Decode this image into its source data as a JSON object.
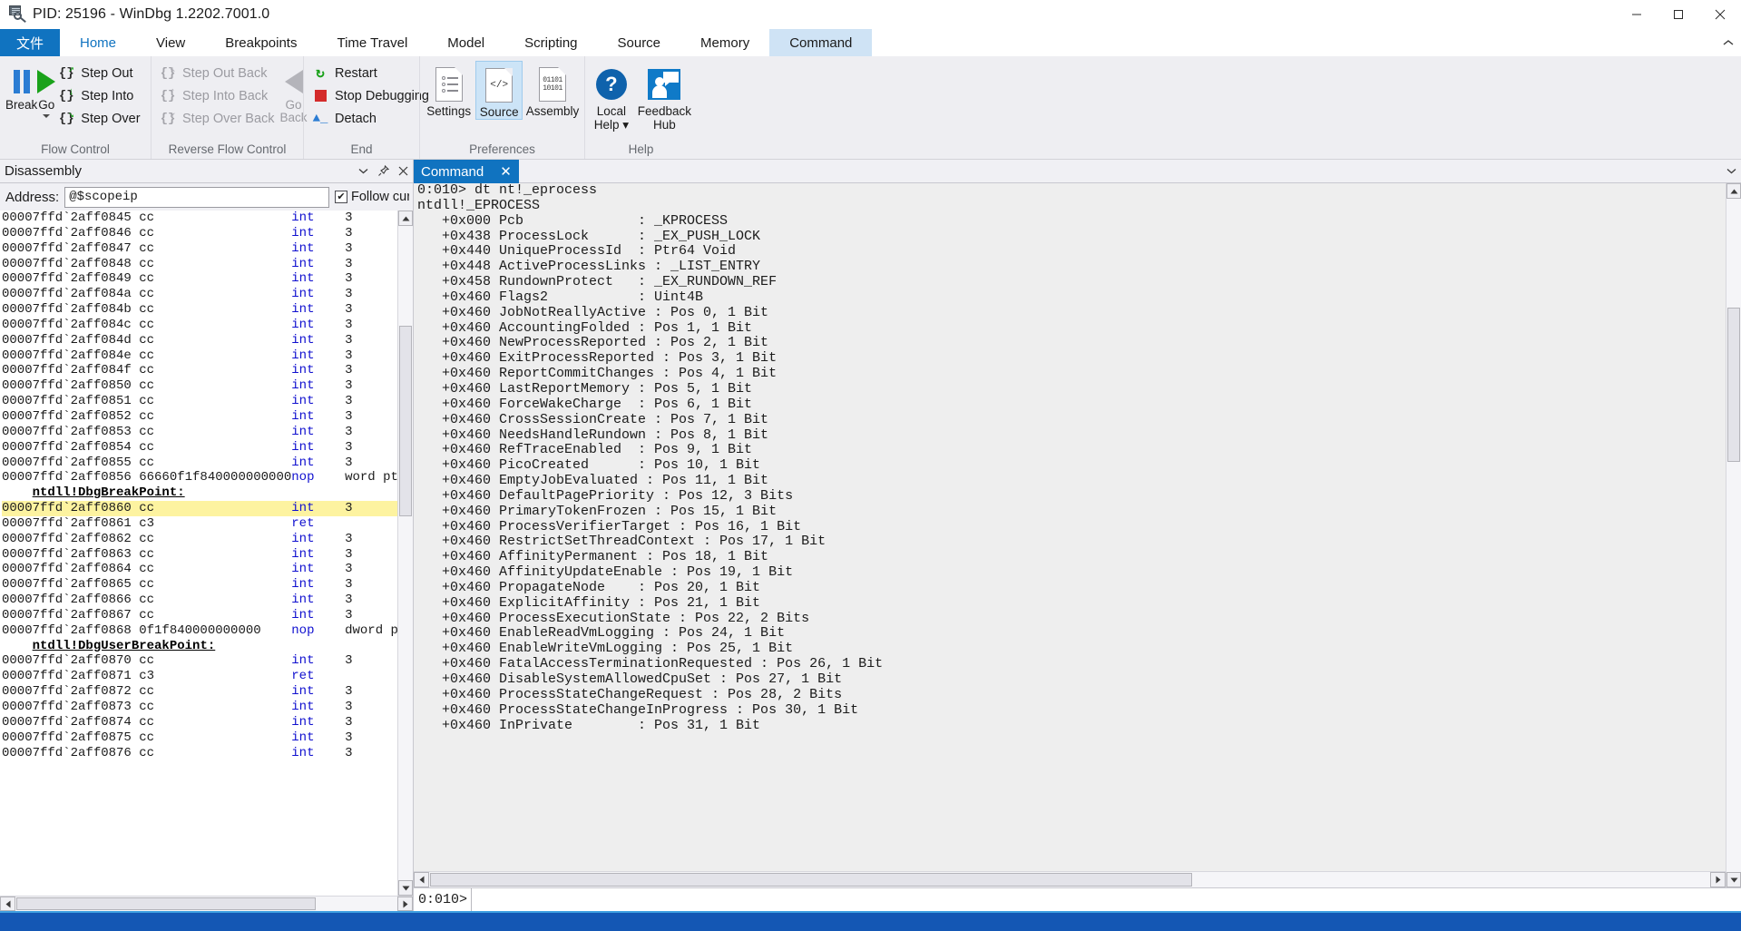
{
  "titlebar": {
    "icon": "windbg-icon",
    "title": "PID: 25196 - WinDbg 1.2202.7001.0",
    "minimize": "—",
    "maximize": "☐",
    "close": "✕"
  },
  "ribbon": {
    "file_tab": "文件",
    "tabs": [
      {
        "label": "Home",
        "active": true,
        "context": false
      },
      {
        "label": "View",
        "active": false,
        "context": false
      },
      {
        "label": "Breakpoints",
        "active": false,
        "context": false
      },
      {
        "label": "Time Travel",
        "active": false,
        "context": false
      },
      {
        "label": "Model",
        "active": false,
        "context": false
      },
      {
        "label": "Scripting",
        "active": false,
        "context": false
      },
      {
        "label": "Source",
        "active": false,
        "context": false
      },
      {
        "label": "Memory",
        "active": false,
        "context": false
      },
      {
        "label": "Command",
        "active": false,
        "context": true
      }
    ],
    "collapse_icon": "chevron-up-icon",
    "groups": {
      "flow_control": {
        "label": "Flow Control",
        "break": "Break",
        "go": "Go",
        "step_out": "Step Out",
        "step_into": "Step Into",
        "step_over": "Step Over"
      },
      "reverse_flow_control": {
        "label": "Reverse Flow Control",
        "step_out_back": "Step Out Back",
        "step_into_back": "Step Into Back",
        "step_over_back": "Step Over Back",
        "go_back_line1": "Go",
        "go_back_line2": "Back"
      },
      "end": {
        "label": "End",
        "restart": "Restart",
        "stop_debugging": "Stop Debugging",
        "detach": "Detach"
      },
      "preferences": {
        "label": "Preferences",
        "settings": "Settings",
        "source": "Source",
        "assembly": "Assembly"
      },
      "help": {
        "label": "Help",
        "local_help_line1": "Local",
        "local_help_line2": "Help",
        "feedback_line1": "Feedback",
        "feedback_line2": "Hub"
      }
    }
  },
  "disassembly": {
    "pane_title": "Disassembly",
    "chevron_icon": "chevron-down-icon",
    "pin_icon": "pin-icon",
    "close_icon": "close-icon",
    "address_label": "Address:",
    "address_value": "@$scopeip",
    "follow_label": "Follow cur",
    "follow_checked": "✔",
    "lines": [
      {
        "addr": "00007ffd`2aff0845",
        "bytes": "cc",
        "mnemonic": "int",
        "operand": "3",
        "highlight": false,
        "symbol": ""
      },
      {
        "addr": "00007ffd`2aff0846",
        "bytes": "cc",
        "mnemonic": "int",
        "operand": "3",
        "highlight": false,
        "symbol": ""
      },
      {
        "addr": "00007ffd`2aff0847",
        "bytes": "cc",
        "mnemonic": "int",
        "operand": "3",
        "highlight": false,
        "symbol": ""
      },
      {
        "addr": "00007ffd`2aff0848",
        "bytes": "cc",
        "mnemonic": "int",
        "operand": "3",
        "highlight": false,
        "symbol": ""
      },
      {
        "addr": "00007ffd`2aff0849",
        "bytes": "cc",
        "mnemonic": "int",
        "operand": "3",
        "highlight": false,
        "symbol": ""
      },
      {
        "addr": "00007ffd`2aff084a",
        "bytes": "cc",
        "mnemonic": "int",
        "operand": "3",
        "highlight": false,
        "symbol": ""
      },
      {
        "addr": "00007ffd`2aff084b",
        "bytes": "cc",
        "mnemonic": "int",
        "operand": "3",
        "highlight": false,
        "symbol": ""
      },
      {
        "addr": "00007ffd`2aff084c",
        "bytes": "cc",
        "mnemonic": "int",
        "operand": "3",
        "highlight": false,
        "symbol": ""
      },
      {
        "addr": "00007ffd`2aff084d",
        "bytes": "cc",
        "mnemonic": "int",
        "operand": "3",
        "highlight": false,
        "symbol": ""
      },
      {
        "addr": "00007ffd`2aff084e",
        "bytes": "cc",
        "mnemonic": "int",
        "operand": "3",
        "highlight": false,
        "symbol": ""
      },
      {
        "addr": "00007ffd`2aff084f",
        "bytes": "cc",
        "mnemonic": "int",
        "operand": "3",
        "highlight": false,
        "symbol": ""
      },
      {
        "addr": "00007ffd`2aff0850",
        "bytes": "cc",
        "mnemonic": "int",
        "operand": "3",
        "highlight": false,
        "symbol": ""
      },
      {
        "addr": "00007ffd`2aff0851",
        "bytes": "cc",
        "mnemonic": "int",
        "operand": "3",
        "highlight": false,
        "symbol": ""
      },
      {
        "addr": "00007ffd`2aff0852",
        "bytes": "cc",
        "mnemonic": "int",
        "operand": "3",
        "highlight": false,
        "symbol": ""
      },
      {
        "addr": "00007ffd`2aff0853",
        "bytes": "cc",
        "mnemonic": "int",
        "operand": "3",
        "highlight": false,
        "symbol": ""
      },
      {
        "addr": "00007ffd`2aff0854",
        "bytes": "cc",
        "mnemonic": "int",
        "operand": "3",
        "highlight": false,
        "symbol": ""
      },
      {
        "addr": "00007ffd`2aff0855",
        "bytes": "cc",
        "mnemonic": "int",
        "operand": "3",
        "highlight": false,
        "symbol": ""
      },
      {
        "addr": "00007ffd`2aff0856",
        "bytes": "66660f1f840000000000",
        "mnemonic": "nop",
        "operand": "word ptr",
        "highlight": false,
        "symbol": ""
      },
      {
        "addr": "",
        "bytes": "",
        "mnemonic": "",
        "operand": "",
        "highlight": false,
        "symbol": "ntdll!DbgBreakPoint:"
      },
      {
        "addr": "00007ffd`2aff0860",
        "bytes": "cc",
        "mnemonic": "int",
        "operand": "3",
        "highlight": true,
        "symbol": ""
      },
      {
        "addr": "00007ffd`2aff0861",
        "bytes": "c3",
        "mnemonic": "ret",
        "operand": "",
        "highlight": false,
        "symbol": ""
      },
      {
        "addr": "00007ffd`2aff0862",
        "bytes": "cc",
        "mnemonic": "int",
        "operand": "3",
        "highlight": false,
        "symbol": ""
      },
      {
        "addr": "00007ffd`2aff0863",
        "bytes": "cc",
        "mnemonic": "int",
        "operand": "3",
        "highlight": false,
        "symbol": ""
      },
      {
        "addr": "00007ffd`2aff0864",
        "bytes": "cc",
        "mnemonic": "int",
        "operand": "3",
        "highlight": false,
        "symbol": ""
      },
      {
        "addr": "00007ffd`2aff0865",
        "bytes": "cc",
        "mnemonic": "int",
        "operand": "3",
        "highlight": false,
        "symbol": ""
      },
      {
        "addr": "00007ffd`2aff0866",
        "bytes": "cc",
        "mnemonic": "int",
        "operand": "3",
        "highlight": false,
        "symbol": ""
      },
      {
        "addr": "00007ffd`2aff0867",
        "bytes": "cc",
        "mnemonic": "int",
        "operand": "3",
        "highlight": false,
        "symbol": ""
      },
      {
        "addr": "00007ffd`2aff0868",
        "bytes": "0f1f840000000000",
        "mnemonic": "nop",
        "operand": "dword pt",
        "highlight": false,
        "symbol": ""
      },
      {
        "addr": "",
        "bytes": "",
        "mnemonic": "",
        "operand": "",
        "highlight": false,
        "symbol": "ntdll!DbgUserBreakPoint:"
      },
      {
        "addr": "00007ffd`2aff0870",
        "bytes": "cc",
        "mnemonic": "int",
        "operand": "3",
        "highlight": false,
        "symbol": ""
      },
      {
        "addr": "00007ffd`2aff0871",
        "bytes": "c3",
        "mnemonic": "ret",
        "operand": "",
        "highlight": false,
        "symbol": ""
      },
      {
        "addr": "00007ffd`2aff0872",
        "bytes": "cc",
        "mnemonic": "int",
        "operand": "3",
        "highlight": false,
        "symbol": ""
      },
      {
        "addr": "00007ffd`2aff0873",
        "bytes": "cc",
        "mnemonic": "int",
        "operand": "3",
        "highlight": false,
        "symbol": ""
      },
      {
        "addr": "00007ffd`2aff0874",
        "bytes": "cc",
        "mnemonic": "int",
        "operand": "3",
        "highlight": false,
        "symbol": ""
      },
      {
        "addr": "00007ffd`2aff0875",
        "bytes": "cc",
        "mnemonic": "int",
        "operand": "3",
        "highlight": false,
        "symbol": ""
      },
      {
        "addr": "00007ffd`2aff0876",
        "bytes": "cc",
        "mnemonic": "int",
        "operand": "3",
        "highlight": false,
        "symbol": ""
      }
    ]
  },
  "command": {
    "tab_label": "Command",
    "tab_close": "✕",
    "chevron_icon": "chevron-down-icon",
    "prompt_label": "0:010>",
    "input_value": "",
    "output": [
      "0:010> dt nt!_eprocess",
      "ntdll!_EPROCESS",
      "   +0x000 Pcb              : _KPROCESS",
      "   +0x438 ProcessLock      : _EX_PUSH_LOCK",
      "   +0x440 UniqueProcessId  : Ptr64 Void",
      "   +0x448 ActiveProcessLinks : _LIST_ENTRY",
      "   +0x458 RundownProtect   : _EX_RUNDOWN_REF",
      "   +0x460 Flags2           : Uint4B",
      "   +0x460 JobNotReallyActive : Pos 0, 1 Bit",
      "   +0x460 AccountingFolded : Pos 1, 1 Bit",
      "   +0x460 NewProcessReported : Pos 2, 1 Bit",
      "   +0x460 ExitProcessReported : Pos 3, 1 Bit",
      "   +0x460 ReportCommitChanges : Pos 4, 1 Bit",
      "   +0x460 LastReportMemory : Pos 5, 1 Bit",
      "   +0x460 ForceWakeCharge  : Pos 6, 1 Bit",
      "   +0x460 CrossSessionCreate : Pos 7, 1 Bit",
      "   +0x460 NeedsHandleRundown : Pos 8, 1 Bit",
      "   +0x460 RefTraceEnabled  : Pos 9, 1 Bit",
      "   +0x460 PicoCreated      : Pos 10, 1 Bit",
      "   +0x460 EmptyJobEvaluated : Pos 11, 1 Bit",
      "   +0x460 DefaultPagePriority : Pos 12, 3 Bits",
      "   +0x460 PrimaryTokenFrozen : Pos 15, 1 Bit",
      "   +0x460 ProcessVerifierTarget : Pos 16, 1 Bit",
      "   +0x460 RestrictSetThreadContext : Pos 17, 1 Bit",
      "   +0x460 AffinityPermanent : Pos 18, 1 Bit",
      "   +0x460 AffinityUpdateEnable : Pos 19, 1 Bit",
      "   +0x460 PropagateNode    : Pos 20, 1 Bit",
      "   +0x460 ExplicitAffinity : Pos 21, 1 Bit",
      "   +0x460 ProcessExecutionState : Pos 22, 2 Bits",
      "   +0x460 EnableReadVmLogging : Pos 24, 1 Bit",
      "   +0x460 EnableWriteVmLogging : Pos 25, 1 Bit",
      "   +0x460 FatalAccessTerminationRequested : Pos 26, 1 Bit",
      "   +0x460 DisableSystemAllowedCpuSet : Pos 27, 1 Bit",
      "   +0x460 ProcessStateChangeRequest : Pos 28, 2 Bits",
      "   +0x460 ProcessStateChangeInProgress : Pos 30, 1 Bit",
      "   +0x460 InPrivate        : Pos 31, 1 Bit"
    ]
  },
  "colors": {
    "accent": "#1073c0",
    "highlight": "#fdf3a0",
    "mnemonic": "#1010cf",
    "ribbon_bg": "#eeeef2",
    "taskbar": "#1457b4"
  }
}
